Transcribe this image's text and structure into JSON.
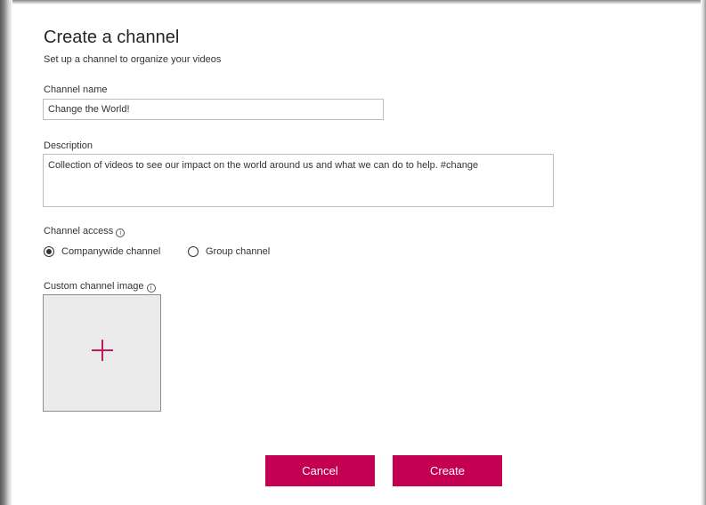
{
  "dialog": {
    "title": "Create a channel",
    "subtitle": "Set up a channel to organize your videos"
  },
  "fields": {
    "channel_name": {
      "label": "Channel name",
      "value": "Change the World!"
    },
    "description": {
      "label": "Description",
      "value": "Collection of videos to see our impact on the world around us and what we can do to help. #change"
    },
    "channel_access": {
      "label": "Channel access",
      "info_icon": "i",
      "options": [
        {
          "label": "Companywide channel",
          "selected": true
        },
        {
          "label": "Group channel",
          "selected": false
        }
      ]
    },
    "custom_image": {
      "label": "Custom channel image",
      "info_icon": "i",
      "add_icon": "plus-icon"
    }
  },
  "buttons": {
    "cancel_label": "Cancel",
    "create_label": "Create"
  },
  "colors": {
    "accent": "#c30052",
    "plus": "#c3185b",
    "image_placeholder": "#ebebeb"
  }
}
